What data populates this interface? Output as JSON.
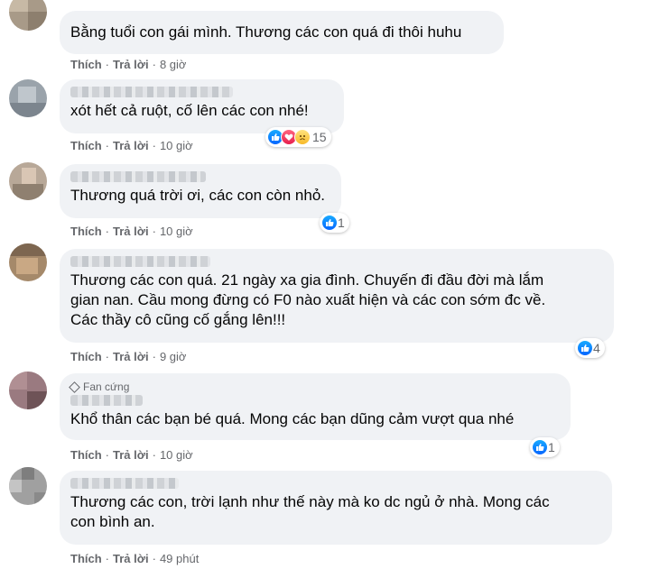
{
  "like_label": "Thích",
  "reply_label": "Trả lời",
  "comments": [
    {
      "text": "Bằng tuổi con gái mình. Thương các con quá đi thôi huhu",
      "time": "8 giờ"
    },
    {
      "text": "xót hết cả ruột, cố lên các con nhé!",
      "time": "10 giờ",
      "reaction_count": "15",
      "reactions": [
        "like-icon",
        "love-icon",
        "sad-icon"
      ]
    },
    {
      "text": "Thương quá trời ơi, các con còn nhỏ.",
      "time": "10 giờ",
      "reaction_count": "1",
      "reactions": [
        "like-icon"
      ]
    },
    {
      "text": "Thương các con quá. 21 ngày xa gia đình. Chuyến đi đầu đời mà lắm\ngian nan. Cầu mong đừng có F0 nào xuất hiện và các con sớm đc về.\nCác thầy cô cũng cố gắng lên!!!",
      "time": "9 giờ",
      "reaction_count": "4",
      "reactions": [
        "like-icon"
      ]
    },
    {
      "badge": "Fan cứng",
      "text": "Khổ thân các bạn bé quá. Mong các bạn dũng cảm vượt qua nhé",
      "time": "10 giờ",
      "reaction_count": "1",
      "reactions": [
        "like-icon"
      ]
    },
    {
      "text": "Thương các con, trời lạnh như thế này mà ko dc ngủ ở nhà. Mong các\ncon bình an.",
      "time": "49 phút"
    }
  ],
  "colors": {
    "bubble": "#f0f2f5",
    "meta": "#65676b",
    "like": "#0866ff"
  }
}
